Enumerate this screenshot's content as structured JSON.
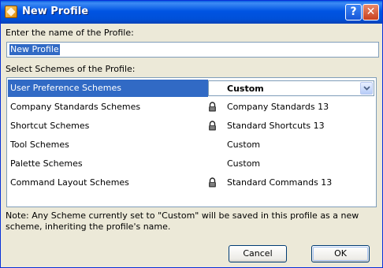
{
  "window": {
    "title": "New Profile",
    "help_label": "?",
    "close_label": "✕"
  },
  "name_section": {
    "label": "Enter the name of the Profile:",
    "value": "New Profile"
  },
  "schemes_section": {
    "label": "Select Schemes of the Profile:"
  },
  "schemes": [
    {
      "name": "User Preference Schemes",
      "value": "Custom",
      "locked": false,
      "selected": true
    },
    {
      "name": "Company Standards Schemes",
      "value": "Company Standards 13",
      "locked": true
    },
    {
      "name": "Shortcut Schemes",
      "value": "Standard Shortcuts 13",
      "locked": true
    },
    {
      "name": "Tool Schemes",
      "value": "Custom",
      "locked": false
    },
    {
      "name": "Palette Schemes",
      "value": "Custom",
      "locked": false
    },
    {
      "name": "Command Layout Schemes",
      "value": "Standard Commands 13",
      "locked": true
    }
  ],
  "note": "Note: Any Scheme currently set to \"Custom\" will be saved in this profile as a new scheme, inheriting the profile's name.",
  "buttons": {
    "cancel": "Cancel",
    "ok": "OK"
  },
  "colors": {
    "selection": "#316ac5",
    "titlebar": "#0054e3",
    "dialog_bg": "#ece9d8"
  },
  "icons": {
    "app": "archicad-icon",
    "lock": "padlock-icon",
    "dropdown": "chevron-down-icon"
  }
}
